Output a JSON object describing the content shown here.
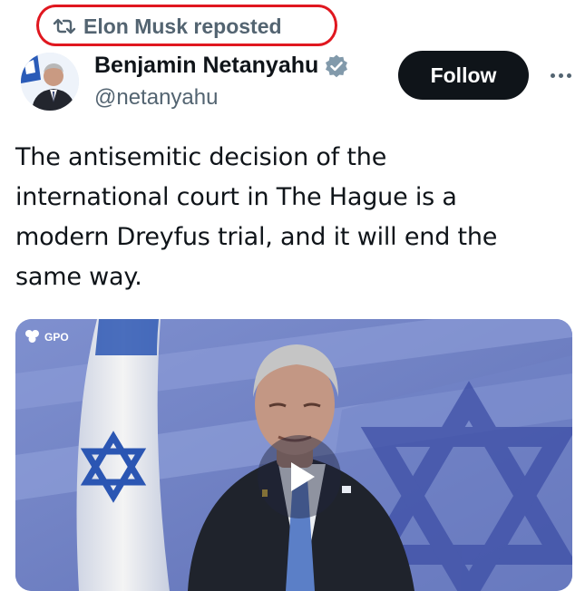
{
  "repost": {
    "text": "Elon Musk reposted",
    "icon": "repost-icon",
    "highlight_color": "#e0171f"
  },
  "author": {
    "name": "Benjamin Netanyahu",
    "handle": "@netanyahu",
    "verified_icon": "verified-badge-icon"
  },
  "follow_button": {
    "label": "Follow"
  },
  "more_button": {
    "icon": "more-options-icon"
  },
  "post": {
    "lines": [
      "The antisemitic decision of the",
      "international court in The Hague is a",
      "modern Dreyfus trial, and it will end the",
      "same way."
    ]
  },
  "media": {
    "watermark": "GPO",
    "play_icon": "play-icon"
  },
  "colors": {
    "text_primary": "#0f1419",
    "text_secondary": "#536471",
    "verified": "#829aab",
    "button_bg": "#0f1419",
    "button_text": "#ffffff"
  }
}
